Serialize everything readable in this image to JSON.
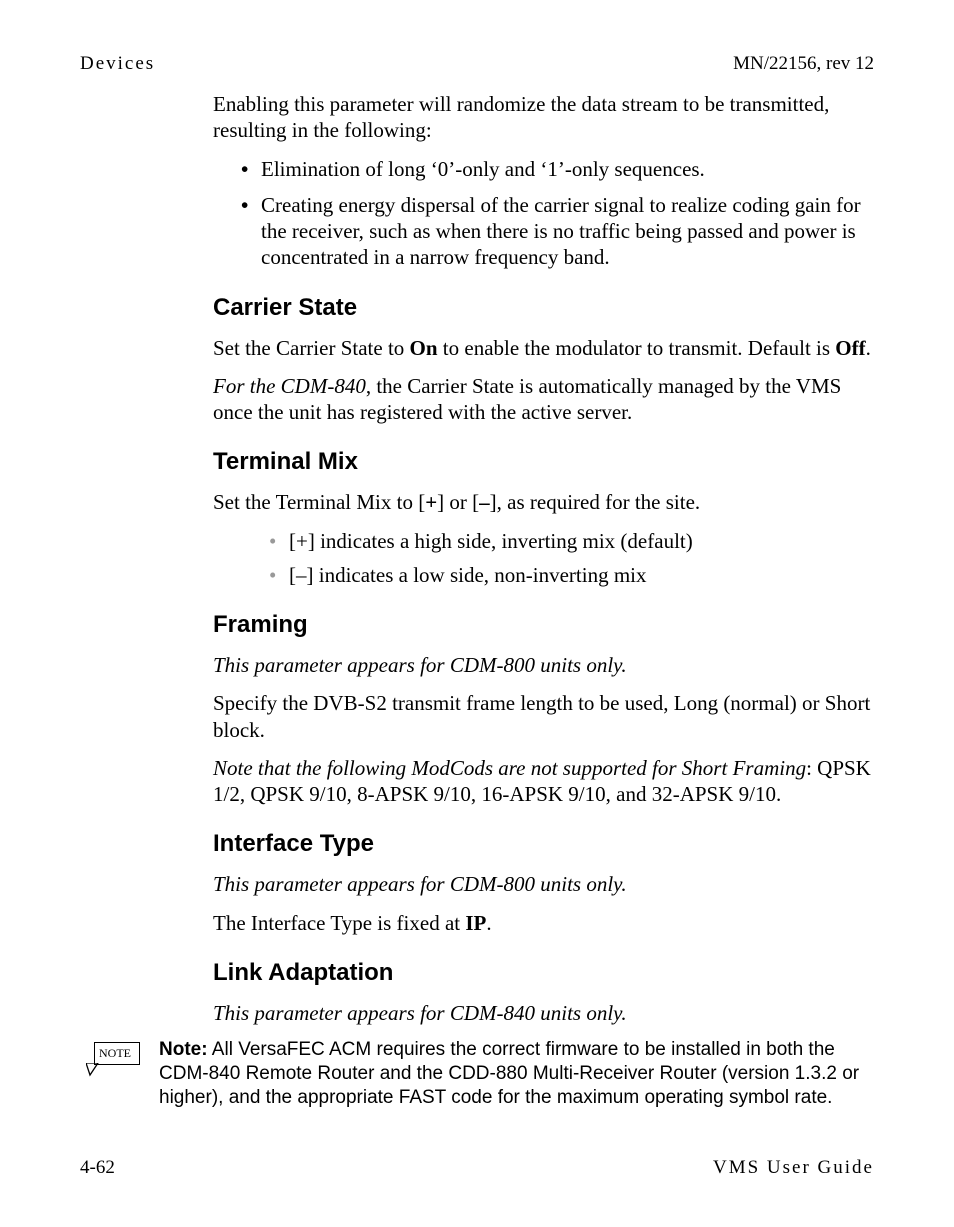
{
  "header": {
    "left": "Devices",
    "right": "MN/22156, rev 12"
  },
  "intro": {
    "p1": "Enabling this parameter will randomize the data stream to be transmitted, resulting in the following:",
    "bullets": [
      "Elimination of long ‘0’-only and ‘1’-only sequences.",
      "Creating energy dispersal of the carrier signal to realize coding gain for the receiver, such as when there is no traffic being passed and power is concentrated in a narrow frequency band."
    ]
  },
  "carrier_state": {
    "heading": "Carrier State",
    "p1_pre": "Set the Carrier State to ",
    "p1_on": "On",
    "p1_mid": " to enable the modulator to transmit. Default is ",
    "p1_off": "Off",
    "p1_post": ".",
    "p2_em": "For the CDM-840",
    "p2_rest": ", the Carrier State is automatically managed by the VMS once the unit has registered with the active server."
  },
  "terminal_mix": {
    "heading": "Terminal Mix",
    "p1_pre": "Set the Terminal Mix to [",
    "p1_plus": "+",
    "p1_mid": "] or [",
    "p1_minus": "–",
    "p1_post": "], as required for the site.",
    "items": [
      "[+] indicates a high side, inverting mix (default)",
      "[–] indicates a low side, non-inverting mix"
    ]
  },
  "framing": {
    "heading": "Framing",
    "p1": "This parameter appears for CDM-800 units only.",
    "p2": "Specify the DVB-S2 transmit frame length to be used, Long (normal) or Short block.",
    "p3_em": "Note that the following ModCods are not supported for Short Framing",
    "p3_rest": ": QPSK 1/2, QPSK 9/10, 8-APSK 9/10, 16-APSK 9/10, and 32-APSK 9/10."
  },
  "interface_type": {
    "heading": "Interface Type",
    "p1": "This parameter appears for CDM-800 units only.",
    "p2_pre": "The Interface Type is fixed at ",
    "p2_ip": "IP",
    "p2_post": "."
  },
  "link_adaptation": {
    "heading": "Link Adaptation",
    "p1": "This parameter appears for CDM-840 units only."
  },
  "note": {
    "icon_label": "NOTE",
    "lead": "Note:",
    "body": "All VersaFEC ACM requires the correct firmware to be installed in both the CDM-840 Remote Router and the CDD-880 Multi-Receiver Router (version 1.3.2 or higher), and the appropriate FAST code for the maximum operating symbol rate."
  },
  "footer": {
    "left": "4-62",
    "right": "VMS User Guide"
  }
}
